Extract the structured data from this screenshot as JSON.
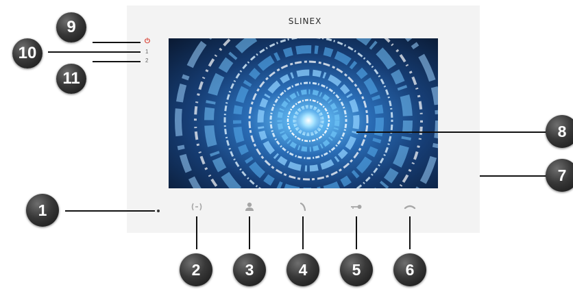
{
  "device": {
    "brand": "SLINEX",
    "indicators": {
      "power_icon": "power-icon",
      "line1_label": "1",
      "line2_label": "2",
      "power_color": "#d83a2c"
    },
    "buttons": [
      {
        "name": "monitor-button",
        "icon": "monitor-icon"
      },
      {
        "name": "user-button",
        "icon": "user-icon"
      },
      {
        "name": "call-button",
        "icon": "handset-icon"
      },
      {
        "name": "unlock-button",
        "icon": "key-icon"
      },
      {
        "name": "hangup-button",
        "icon": "hangup-icon"
      }
    ]
  },
  "callouts": {
    "c1": "1",
    "c2": "2",
    "c3": "3",
    "c4": "4",
    "c5": "5",
    "c6": "6",
    "c7": "7",
    "c8": "8",
    "c9": "9",
    "c10": "10",
    "c11": "11"
  },
  "colors": {
    "badge": "#2b2b2b",
    "device_body": "#f3f3f3",
    "button_icon": "#a6a6a6"
  }
}
